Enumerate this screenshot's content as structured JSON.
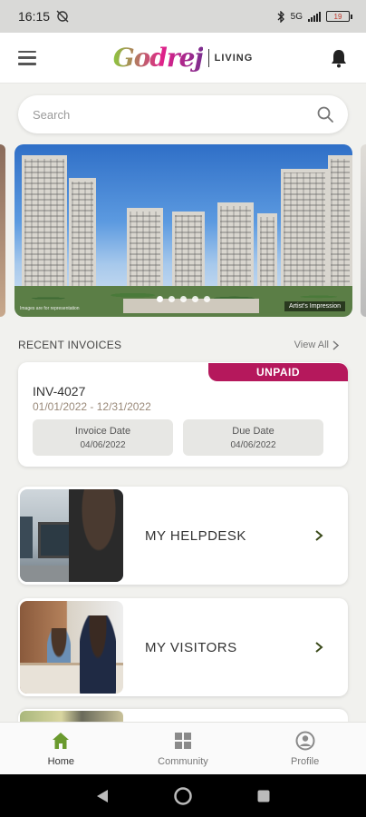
{
  "status_bar": {
    "time": "16:15",
    "network": "5G",
    "battery": "19"
  },
  "header": {
    "logo_script": "Godrej",
    "logo_word": "LIVING"
  },
  "search": {
    "placeholder": "Search"
  },
  "carousel": {
    "caption": "Artist's Impression",
    "credit": "Images are for representation",
    "dot_count": 5,
    "active_dot": 0
  },
  "invoices": {
    "section_title": "RECENT INVOICES",
    "view_all": "View All",
    "card": {
      "status": "UNPAID",
      "number": "INV-4027",
      "period": "01/01/2022 - 12/31/2022",
      "invoice_date_label": "Invoice Date",
      "invoice_date": "04/06/2022",
      "due_date_label": "Due Date",
      "due_date": "04/06/2022"
    }
  },
  "menu": {
    "helpdesk": "MY HELPDESK",
    "visitors": "MY VISITORS"
  },
  "bottom_nav": {
    "items": [
      {
        "label": "Home",
        "icon": "home-icon",
        "active": true
      },
      {
        "label": "Community",
        "icon": "grid-icon",
        "active": false
      },
      {
        "label": "Profile",
        "icon": "profile-icon",
        "active": false
      }
    ]
  },
  "colors": {
    "accent": "#6a9a2e",
    "unpaid_badge": "#b5185c"
  }
}
